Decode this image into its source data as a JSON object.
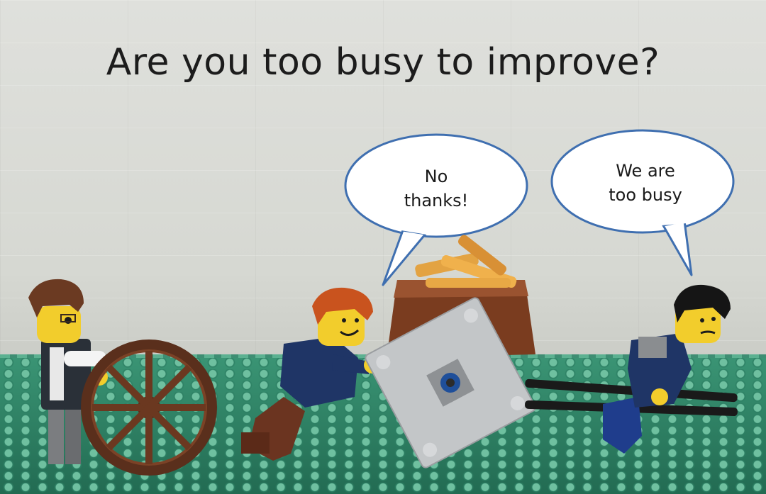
{
  "headline": "Are you too busy to improve?",
  "bubbles": {
    "left": {
      "line1": "No",
      "line2": "thanks!"
    },
    "right": {
      "line1": "We are",
      "line2": "too busy"
    }
  }
}
